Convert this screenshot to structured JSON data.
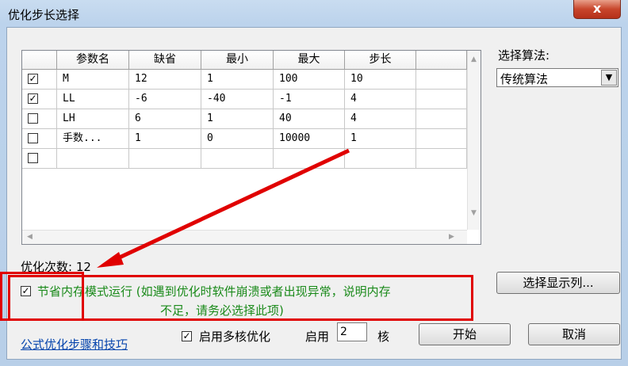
{
  "window": {
    "title": "优化步长选择",
    "close_label": "x"
  },
  "table": {
    "columns": [
      "参数名",
      "缺省",
      "最小",
      "最大",
      "步长",
      ""
    ],
    "rows": [
      {
        "checked": true,
        "name": "M",
        "default": "12",
        "min": "1",
        "max": "100",
        "step": "10",
        "extra": ""
      },
      {
        "checked": true,
        "name": "LL",
        "default": "-6",
        "min": "-40",
        "max": "-1",
        "step": "4",
        "extra": ""
      },
      {
        "checked": false,
        "name": "LH",
        "default": "6",
        "min": "1",
        "max": "40",
        "step": "4",
        "extra": ""
      },
      {
        "checked": false,
        "name": "手数...",
        "default": "1",
        "min": "0",
        "max": "10000",
        "step": "1",
        "extra": ""
      },
      {
        "checked": false,
        "name": "",
        "default": "",
        "min": "",
        "max": "",
        "step": "",
        "extra": ""
      }
    ]
  },
  "algorithm": {
    "label": "选择算法:",
    "selected": "传统算法"
  },
  "optimize_count_label": "优化次数: 12",
  "save_memory": {
    "checked": true,
    "line1": "节省内存模式运行 (如遇到优化时软件崩溃或者出现异常，说明内存",
    "line2": "不足，请务必选择此项)"
  },
  "buttons": {
    "show_columns": "选择显示列...",
    "start": "开始",
    "cancel": "取消"
  },
  "multicore": {
    "checked": true,
    "label": "启用多核优化",
    "enable_label": "启用",
    "cores": "2",
    "cores_suffix": "核"
  },
  "link_label": "公式优化步骤和技巧",
  "colors": {
    "annotation": "#e00000",
    "note_text": "#1a8a1a",
    "link": "#0645ad"
  }
}
